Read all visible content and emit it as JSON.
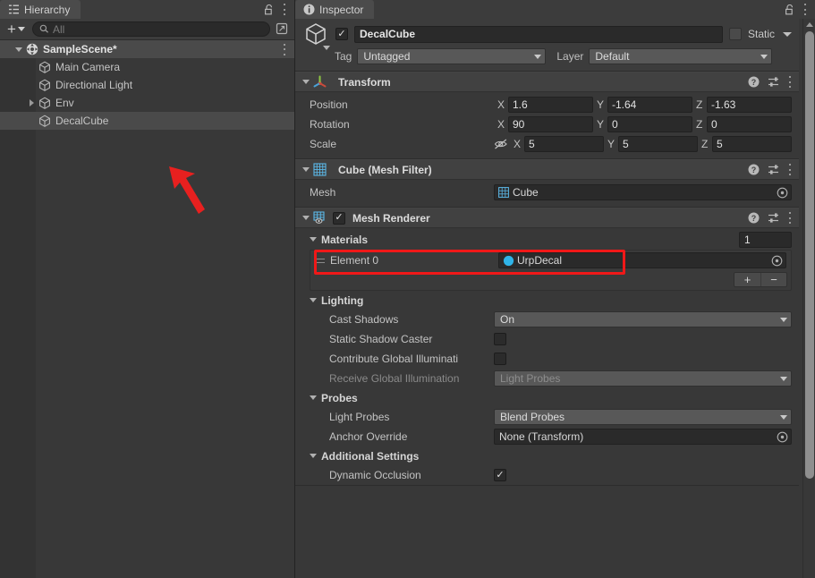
{
  "hierarchy": {
    "tab_label": "Hierarchy",
    "tab_icon": "hierarchy-icon",
    "lock_icon": "lock-icon",
    "menu_icon": "kebab-menu-icon",
    "toolbar": {
      "add_label": "+",
      "search_placeholder": "All",
      "search_icon": "search-icon",
      "sync_icon": "sync-selection-icon"
    },
    "rows": [
      {
        "label": "SampleScene*",
        "icon": "unity-scene-icon",
        "depth": 0,
        "foldout": "down",
        "selected": false,
        "is_scene": true,
        "has_kebab": true
      },
      {
        "label": "Main Camera",
        "icon": "gameobject-cube-icon",
        "depth": 1,
        "foldout": "none",
        "selected": false,
        "is_scene": false,
        "has_kebab": false
      },
      {
        "label": "Directional Light",
        "icon": "gameobject-cube-icon",
        "depth": 1,
        "foldout": "none",
        "selected": false,
        "is_scene": false,
        "has_kebab": false
      },
      {
        "label": "Env",
        "icon": "gameobject-cube-icon",
        "depth": 1,
        "foldout": "right",
        "selected": false,
        "is_scene": false,
        "has_kebab": false
      },
      {
        "label": "DecalCube",
        "icon": "gameobject-cube-icon",
        "depth": 1,
        "foldout": "none",
        "selected": true,
        "is_scene": false,
        "has_kebab": false
      }
    ]
  },
  "inspector": {
    "tab_label": "Inspector",
    "tab_icon": "info-icon",
    "lock_icon": "lock-icon",
    "menu_icon": "kebab-menu-icon",
    "gameobject": {
      "enabled": true,
      "icon": "gameobject-cube-icon",
      "name": "DecalCube",
      "static_label": "Static",
      "static_checked": false,
      "tag_label": "Tag",
      "tag_value": "Untagged",
      "layer_label": "Layer",
      "layer_value": "Default"
    },
    "transform": {
      "title": "Transform",
      "icon": "transform-axis-icon",
      "expanded": true,
      "rows": [
        {
          "label": "Position",
          "x": "1.6",
          "y": "-1.64",
          "z": "-1.63",
          "link_icon": null
        },
        {
          "label": "Rotation",
          "x": "90",
          "y": "0",
          "z": "0",
          "link_icon": null
        },
        {
          "label": "Scale",
          "x": "5",
          "y": "5",
          "z": "5",
          "link_icon": "constrain-proportions-off-icon"
        }
      ],
      "axis_labels": {
        "x": "X",
        "y": "Y",
        "z": "Z"
      }
    },
    "mesh_filter": {
      "title": "Cube (Mesh Filter)",
      "icon": "mesh-filter-icon",
      "expanded": true,
      "mesh_label": "Mesh",
      "mesh_value": "Cube",
      "mesh_value_icon": "mesh-icon",
      "picker_icon": "object-picker-icon"
    },
    "mesh_renderer": {
      "title": "Mesh Renderer",
      "icon": "mesh-renderer-icon",
      "enabled": true,
      "expanded": true,
      "materials": {
        "section_title": "Materials",
        "size": "1",
        "element_label": "Element 0",
        "element_value": "UrpDecal",
        "element_value_icon": "material-sphere-icon",
        "picker_icon": "object-picker-icon",
        "add_label": "+",
        "remove_label": "−",
        "highlighted": true,
        "highlight_color": "#f01818"
      },
      "lighting": {
        "section_title": "Lighting",
        "rows": [
          {
            "label": "Cast Shadows",
            "type": "dropdown",
            "value": "On",
            "disabled": false
          },
          {
            "label": "Static Shadow Caster",
            "type": "checkbox",
            "value": false,
            "disabled": false
          },
          {
            "label": "Contribute Global Illuminati",
            "type": "checkbox",
            "value": false,
            "disabled": false
          },
          {
            "label": "Receive Global Illumination",
            "type": "dropdown",
            "value": "Light Probes",
            "disabled": true
          }
        ]
      },
      "probes": {
        "section_title": "Probes",
        "rows": [
          {
            "label": "Light Probes",
            "type": "dropdown",
            "value": "Blend Probes",
            "disabled": false
          },
          {
            "label": "Anchor Override",
            "type": "object",
            "value": "None (Transform)",
            "disabled": false
          }
        ]
      },
      "additional_settings": {
        "section_title": "Additional Settings",
        "rows": [
          {
            "label": "Dynamic Occlusion",
            "type": "checkbox",
            "value": true,
            "disabled": false
          }
        ]
      }
    },
    "help_icon": "help-icon",
    "preset_icon": "preset-icon",
    "kebab_icon": "kebab-menu-icon"
  },
  "annotation": {
    "arrow_color": "#e8201f",
    "arrow_target": "DecalCube",
    "highlight_box_color": "#f01818",
    "highlight_box_target": "Element 0 material slot"
  }
}
